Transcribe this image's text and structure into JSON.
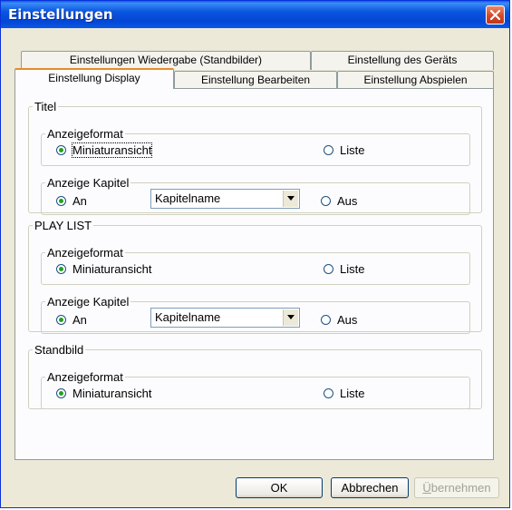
{
  "window": {
    "title": "Einstellungen",
    "close_icon": "close-icon"
  },
  "tabs": {
    "back_row": [
      "Einstellungen Wiedergabe (Standbilder)",
      "Einstellung des Geräts"
    ],
    "front_row": [
      "Einstellung Display",
      "Einstellung Bearbeiten",
      "Einstellung Abspielen"
    ],
    "active": "Einstellung Display"
  },
  "sections": {
    "titel": {
      "label": "Titel",
      "format_group": "Anzeigeformat",
      "format_option_1": "Miniaturansicht",
      "format_option_2": "Liste",
      "chapter_group": "Anzeige Kapitel",
      "chapter_on": "An",
      "chapter_select": "Kapitelname",
      "chapter_off": "Aus"
    },
    "playlist": {
      "label": "PLAY LIST",
      "format_group": "Anzeigeformat",
      "format_option_1": "Miniaturansicht",
      "format_option_2": "Liste",
      "chapter_group": "Anzeige Kapitel",
      "chapter_on": "An",
      "chapter_select": "Kapitelname",
      "chapter_off": "Aus"
    },
    "standbild": {
      "label": "Standbild",
      "format_group": "Anzeigeformat",
      "format_option_1": "Miniaturansicht",
      "format_option_2": "Liste"
    }
  },
  "buttons": {
    "ok": "OK",
    "cancel": "Abbrechen",
    "apply_first": "Ü",
    "apply_rest": "bernehmen"
  },
  "colors": {
    "titlebar": "#0a55e0",
    "accent_tab": "#e68b2c",
    "radio_checked": "#21a121",
    "face": "#ece9d8"
  }
}
